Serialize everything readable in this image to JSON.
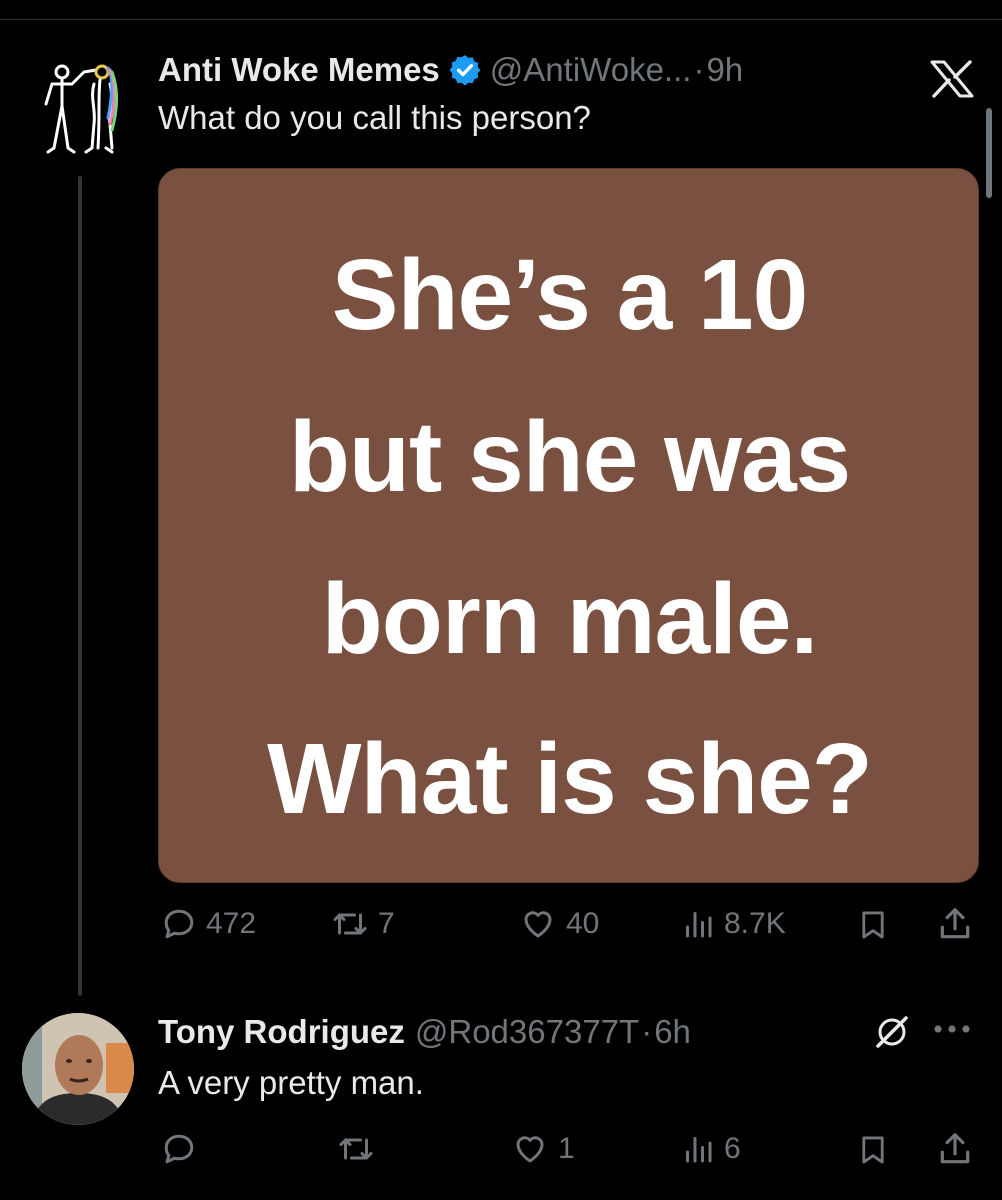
{
  "tweet": {
    "author_name": "Anti Woke Memes",
    "handle": "@AntiWoke...",
    "separator": "·",
    "time": "9h",
    "text": "What do you call this person?",
    "image_lines": [
      "She’s a 10",
      "but she was",
      "born male.",
      "What is she?"
    ],
    "stats": {
      "replies": "472",
      "reposts": "7",
      "likes": "40",
      "views": "8.7K"
    }
  },
  "reply": {
    "author_name": "Tony Rodriguez",
    "handle": "@Rod367377T",
    "separator": "·",
    "time": "6h",
    "text": "A very pretty man.",
    "stats": {
      "replies": "",
      "reposts": "",
      "likes": "1",
      "views": "6"
    }
  },
  "icons": {
    "verified": "verified-badge-icon",
    "close": "x-logo-icon",
    "reply": "reply-icon",
    "repost": "repost-icon",
    "like": "heart-icon",
    "views": "views-icon",
    "bookmark": "bookmark-icon",
    "share": "share-icon",
    "grok": "grok-icon",
    "more": "more-icon"
  },
  "colors": {
    "background": "#000000",
    "text": "#e7e9ea",
    "muted": "#71767b",
    "verified": "#1d9bf0",
    "media_background": "#7a5140"
  }
}
